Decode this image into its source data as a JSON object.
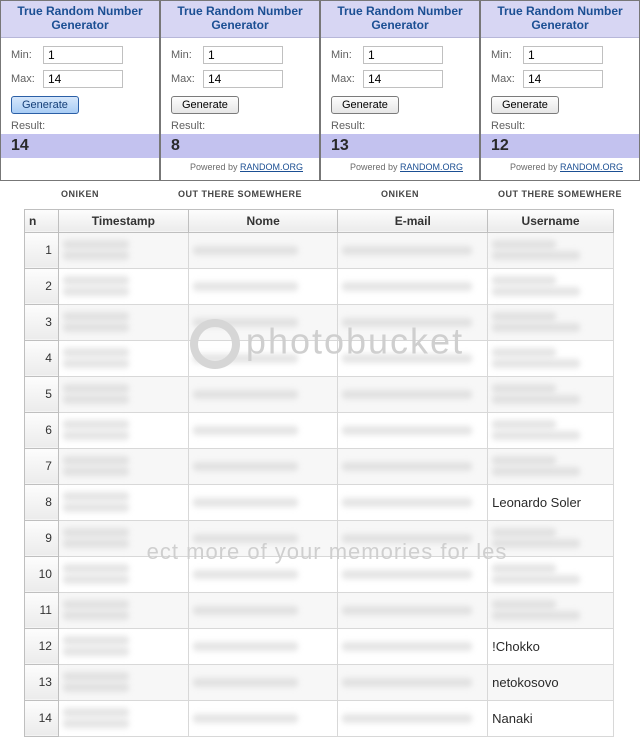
{
  "generators": [
    {
      "title": "True Random Number Generator",
      "min_label": "Min:",
      "min_value": "1",
      "max_label": "Max:",
      "max_value": "14",
      "btn": "Generate",
      "result_label": "Result:",
      "result": "14",
      "btn_style": "blue",
      "powered": false
    },
    {
      "title": "True Random Number Generator",
      "min_label": "Min:",
      "min_value": "1",
      "max_label": "Max:",
      "max_value": "14",
      "btn": "Generate",
      "result_label": "Result:",
      "result": "8",
      "btn_style": "grey",
      "powered": true
    },
    {
      "title": "True Random Number Generator",
      "min_label": "Min:",
      "min_value": "1",
      "max_label": "Max:",
      "max_value": "14",
      "btn": "Generate",
      "result_label": "Result:",
      "result": "13",
      "btn_style": "grey",
      "powered": true
    },
    {
      "title": "True Random Number Generator",
      "min_label": "Min:",
      "min_value": "1",
      "max_label": "Max:",
      "max_value": "14",
      "btn": "Generate",
      "result_label": "Result:",
      "result": "12",
      "btn_style": "grey",
      "powered": true
    }
  ],
  "powered_text": "Powered by ",
  "powered_link": "RANDOM.ORG",
  "prize_labels": [
    "ONIKEN",
    "OUT THERE SOMEWHERE",
    "ONIKEN",
    "OUT THERE SOMEWHERE"
  ],
  "table": {
    "headers": {
      "n": "n",
      "timestamp": "Timestamp",
      "nome": "Nome",
      "email": "E-mail",
      "username": "Username"
    },
    "rows": [
      {
        "n": "1"
      },
      {
        "n": "2"
      },
      {
        "n": "3"
      },
      {
        "n": "4"
      },
      {
        "n": "5"
      },
      {
        "n": "6"
      },
      {
        "n": "7"
      },
      {
        "n": "8",
        "username": "Leonardo Soler"
      },
      {
        "n": "9"
      },
      {
        "n": "10"
      },
      {
        "n": "11"
      },
      {
        "n": "12",
        "username": "!Chokko"
      },
      {
        "n": "13",
        "username": "netokosovo"
      },
      {
        "n": "14",
        "username": "Nanaki"
      }
    ]
  },
  "watermark": {
    "brand": "photobucket",
    "tagline": "ect more of your memories for les"
  }
}
